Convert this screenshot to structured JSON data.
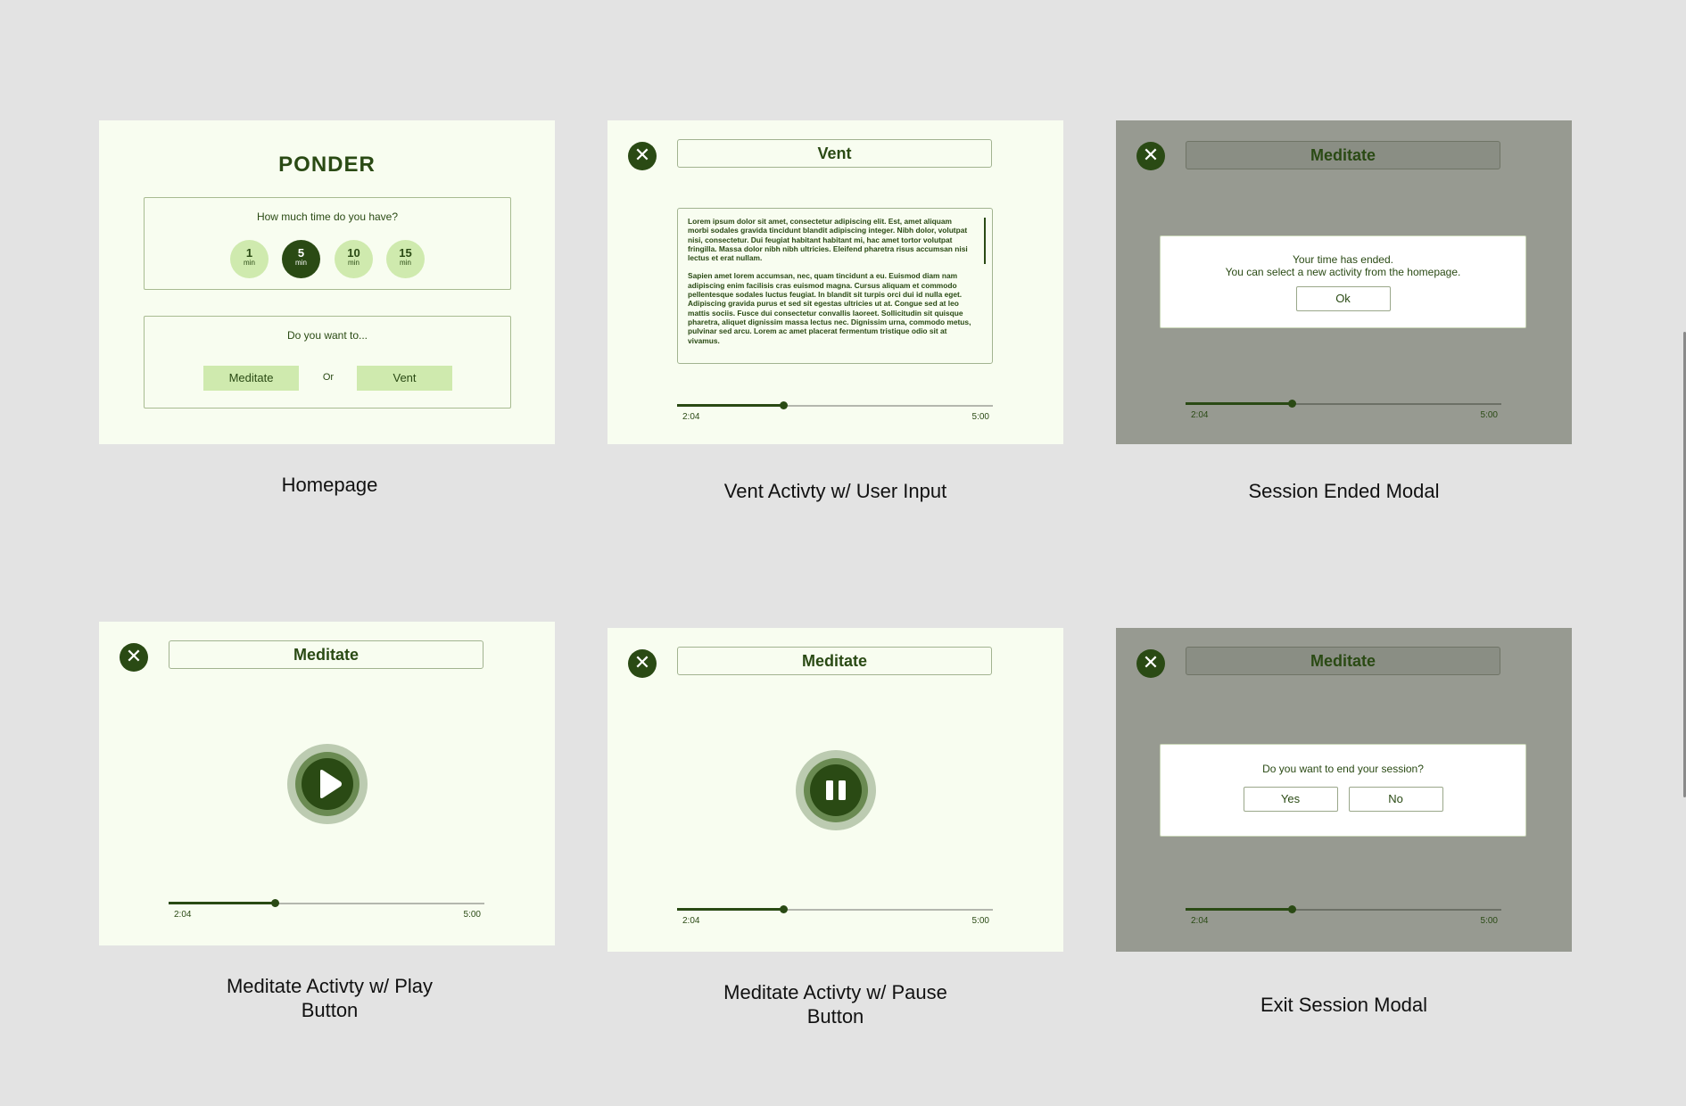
{
  "screens": [
    {
      "caption": "Homepage",
      "brand": "PONDER",
      "time_question": "How much time do you have?",
      "time_options": [
        {
          "num": "1",
          "unit": "min"
        },
        {
          "num": "5",
          "unit": "min",
          "selected": true
        },
        {
          "num": "10",
          "unit": "min"
        },
        {
          "num": "15",
          "unit": "min"
        }
      ],
      "activity_question": "Do you want to...",
      "meditate_label": "Meditate",
      "or_label": "Or",
      "vent_label": "Vent"
    },
    {
      "caption": "Vent Activty w/ User Input",
      "title": "Vent",
      "close_icon": "close-icon",
      "paragraph_1": "Lorem ipsum dolor sit amet, consectetur adipiscing elit. Est, amet aliquam morbi sodales gravida tincidunt blandit adipiscing integer. Nibh dolor, volutpat nisi, consectetur. Dui feugiat habitant habitant mi, hac amet tortor volutpat fringilla. Massa dolor nibh nibh ultricies. Eleifend pharetra risus accumsan nisi lectus et erat nullam.",
      "paragraph_2": "Sapien amet lorem accumsan, nec, quam tincidunt a eu. Euismod diam nam adipiscing enim facilisis cras euismod magna. Cursus aliquam et commodo pellentesque sodales luctus feugiat. In blandit sit turpis orci dui id nulla eget. Adipiscing gravida purus et sed sit egestas ultricies ut at. Congue sed at leo mattis sociis. Fusce dui consectetur convallis laoreet. Sollicitudin sit quisque pharetra, aliquet dignissim massa lectus nec. Dignissim urna, commodo metus, pulvinar sed arcu. Lorem ac amet placerat fermentum tristique odio sit at vivamus.",
      "time_elapsed": "2:04",
      "time_total": "5:00",
      "progress": 0.335
    },
    {
      "caption": "Session Ended Modal",
      "title": "Meditate",
      "modal_line_1": "Your time has ended.",
      "modal_line_2": "You can select a new activity from the homepage.",
      "ok_label": "Ok",
      "time_elapsed": "2:04",
      "time_total": "5:00",
      "progress": 0.335
    },
    {
      "caption": "Meditate Activty w/ Play Button",
      "title": "Meditate",
      "media_icon": "play-icon",
      "time_elapsed": "2:04",
      "time_total": "5:00",
      "progress": 0.335
    },
    {
      "caption": "Meditate Activty w/ Pause Button",
      "title": "Meditate",
      "media_icon": "pause-icon",
      "time_elapsed": "2:04",
      "time_total": "5:00",
      "progress": 0.335
    },
    {
      "caption": "Exit Session Modal",
      "title": "Meditate",
      "modal_question": "Do you want to end your session?",
      "yes_label": "Yes",
      "no_label": "No",
      "time_elapsed": "2:04",
      "time_total": "5:00",
      "progress": 0.335
    }
  ],
  "colors": {
    "background": "#e3e3e3",
    "screen_bg": "#f8fdf0",
    "dimmed_screen_bg": "#979a91",
    "primary_dark_green": "#2a4a14",
    "light_green": "#cfeaae"
  }
}
